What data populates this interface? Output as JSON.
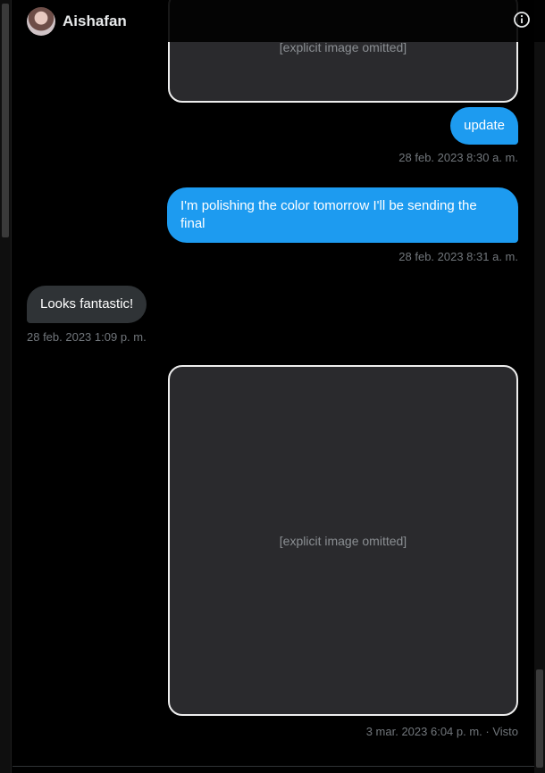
{
  "header": {
    "title": "Aishafan",
    "info_icon": "info-circle-icon"
  },
  "messages": [
    {
      "type": "image",
      "direction": "out",
      "description": "[explicit image omitted]"
    },
    {
      "type": "text",
      "direction": "out",
      "text": "update",
      "timestamp": "28 feb. 2023 8:30 a. m."
    },
    {
      "type": "text",
      "direction": "out",
      "text": "I'm polishing the color tomorrow I'll be sending the final",
      "timestamp": "28 feb. 2023 8:31 a. m."
    },
    {
      "type": "text",
      "direction": "in",
      "text": "Looks fantastic!",
      "timestamp": "28 feb. 2023 1:09 p. m."
    },
    {
      "type": "image",
      "direction": "out",
      "description": "[explicit image omitted]",
      "timestamp": "3 mar. 2023 6:04 p. m. · Visto"
    }
  ],
  "colors": {
    "outgoing_bubble": "#1d9bf0",
    "incoming_bubble": "#2f3336",
    "timestamp": "#71767b",
    "background": "#000000"
  }
}
